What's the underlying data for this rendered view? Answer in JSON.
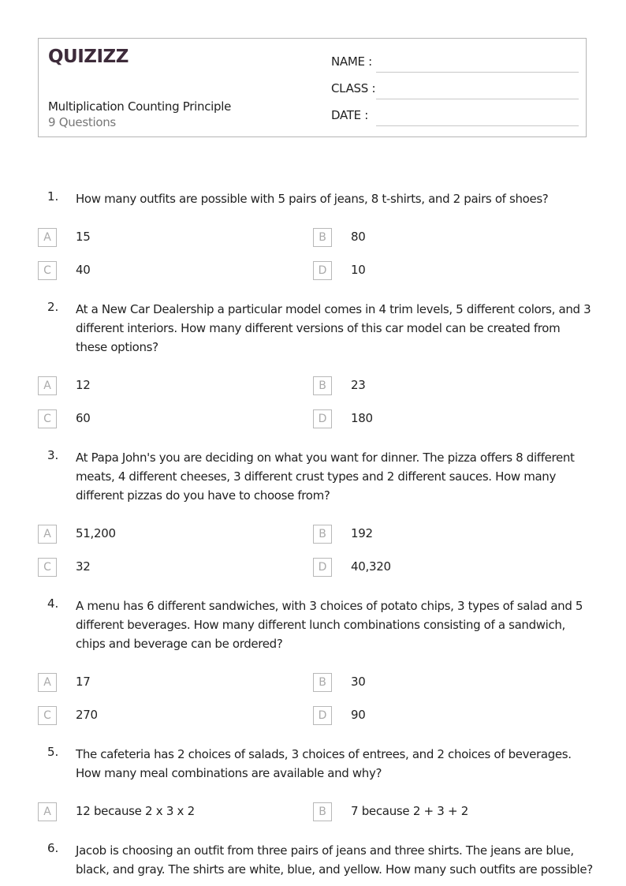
{
  "header": {
    "logo": "QUIZIZZ",
    "title": "Multiplication Counting Principle",
    "question_count": "9 Questions",
    "fields": [
      {
        "label": "NAME :"
      },
      {
        "label": "CLASS :"
      },
      {
        "label": "DATE  :"
      }
    ]
  },
  "questions": [
    {
      "number": "1.",
      "text": "How many outfits are possible with 5 pairs of jeans, 8 t-shirts, and 2 pairs of shoes?",
      "options": [
        {
          "letter": "A",
          "value": "15"
        },
        {
          "letter": "B",
          "value": "80"
        },
        {
          "letter": "C",
          "value": "40"
        },
        {
          "letter": "D",
          "value": "10"
        }
      ]
    },
    {
      "number": "2.",
      "text": "At  a New Car Dealership a particular model comes in 4 trim levels, 5 different colors, and 3 different interiors. How many different versions of this car model can be created from these options?",
      "options": [
        {
          "letter": "A",
          "value": "12"
        },
        {
          "letter": "B",
          "value": "23"
        },
        {
          "letter": "C",
          "value": "60"
        },
        {
          "letter": "D",
          "value": "180"
        }
      ]
    },
    {
      "number": "3.",
      "text": "At Papa John's you are deciding on what you want for dinner. The pizza offers 8 different meats, 4 different cheeses, 3 different crust types and 2 different sauces. How many different pizzas do you have to choose from?",
      "options": [
        {
          "letter": "A",
          "value": "51,200"
        },
        {
          "letter": "B",
          "value": "192"
        },
        {
          "letter": "C",
          "value": "32"
        },
        {
          "letter": "D",
          "value": "40,320"
        }
      ]
    },
    {
      "number": "4.",
      "text": "A menu has 6 different sandwiches, with 3 choices of potato chips, 3 types of salad and 5 different beverages. How many different lunch combinations consisting of a sandwich, chips and beverage can be ordered?",
      "options": [
        {
          "letter": "A",
          "value": "17"
        },
        {
          "letter": "B",
          "value": "30"
        },
        {
          "letter": "C",
          "value": "270"
        },
        {
          "letter": "D",
          "value": "90"
        }
      ]
    },
    {
      "number": "5.",
      "text": "The cafeteria has 2 choices of salads, 3 choices of entrees, and 2 choices of beverages. How many meal combinations are available and why?",
      "options": [
        {
          "letter": "A",
          "value": "12 because 2 x 3 x 2"
        },
        {
          "letter": "B",
          "value": "7 because 2 + 3 + 2"
        }
      ]
    },
    {
      "number": "6.",
      "text": "Jacob is choosing an outfit from three pairs of jeans and three shirts.  The jeans are blue, black, and gray.  The shirts are white, blue, and yellow.  How many such outfits are possible?",
      "options": []
    }
  ]
}
